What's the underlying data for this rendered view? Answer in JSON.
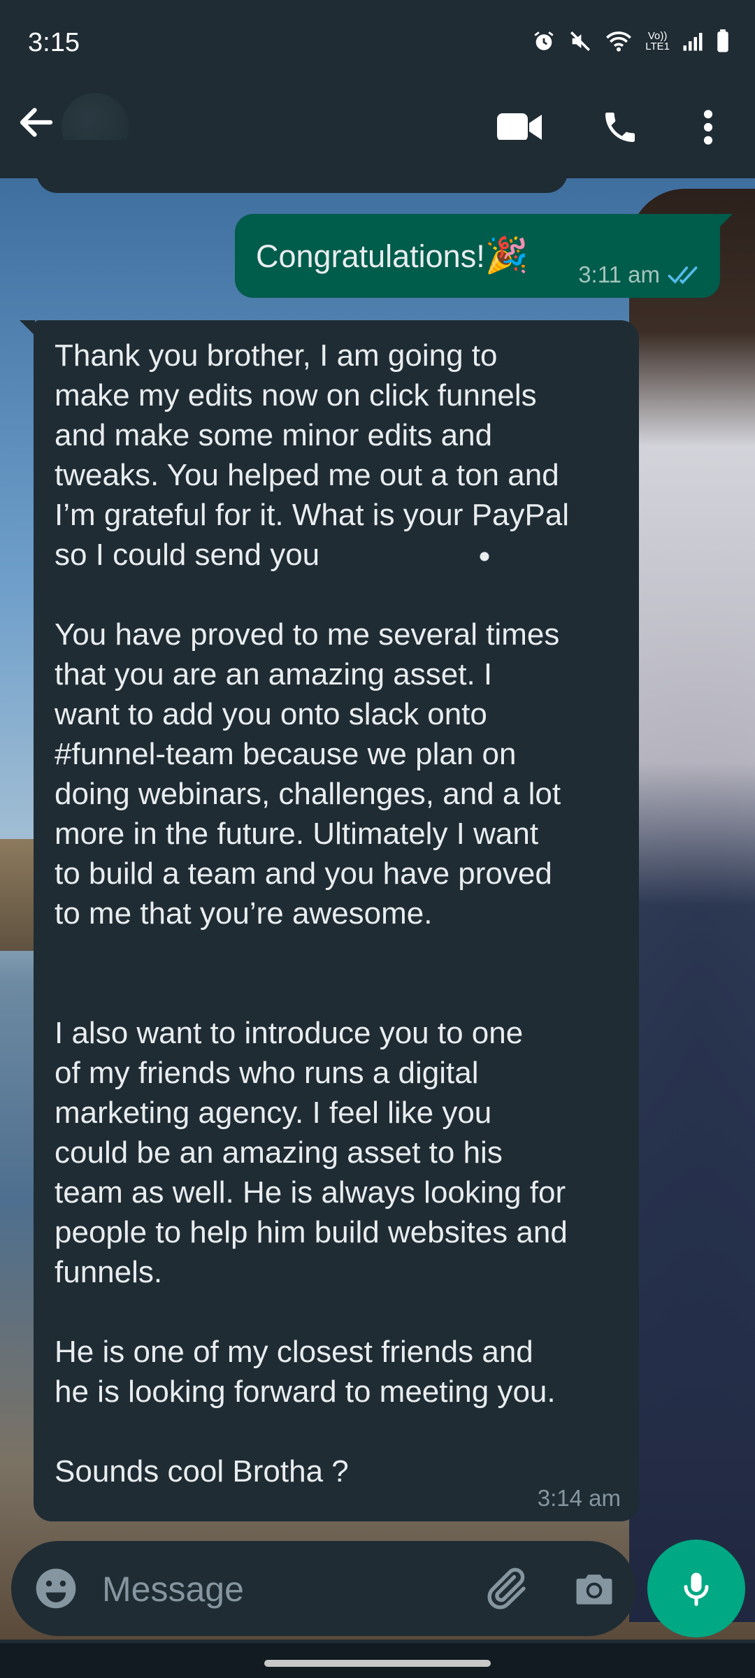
{
  "status_bar": {
    "time": "3:15",
    "network_label": "Vo))\nLTE1",
    "icons": [
      "alarm-icon",
      "mute-icon",
      "wifi-icon",
      "volte-icon",
      "signal-icon",
      "battery-icon"
    ]
  },
  "app_bar": {
    "icons": [
      "back-arrow-icon",
      "video-call-icon",
      "phone-call-icon",
      "more-vert-icon"
    ]
  },
  "messages": [
    {
      "direction": "outgoing",
      "text": "Congratulations!",
      "emoji": "🎉",
      "time": "3:11 am",
      "status": "read"
    },
    {
      "direction": "incoming",
      "para1": "Thank you brother, I am going to\nmake my edits now on click funnels\nand make some minor edits and\ntweaks. You helped me out a ton and\nI’m grateful for it. What is your PayPal\nso I could send you",
      "para2": "You have proved to me several times\nthat you are an amazing asset. I\nwant to add you onto slack onto\n#funnel-team because we plan on\ndoing webinars, challenges, and a lot\nmore in the future. Ultimately I want\nto build a team and you have proved\nto me that you’re awesome.",
      "para3": "I also want to introduce you to one\nof my friends who runs a  digital\nmarketing agency. I feel like you\ncould be an amazing asset to his\nteam as well. He is always looking for\npeople to help him build websites and\nfunnels.",
      "para4": "He is one of my closest friends and\nhe is looking forward to meeting you.",
      "para5": "Sounds cool Brotha ?",
      "time": "3:14 am"
    }
  ],
  "composer": {
    "placeholder": "Message",
    "value": ""
  },
  "colors": {
    "header_bg": "#1f2c34",
    "outgoing_bubble": "#005c4b",
    "incoming_bubble": "#1f2c34",
    "accent": "#00a884",
    "read_ticks": "#53bdeb"
  }
}
